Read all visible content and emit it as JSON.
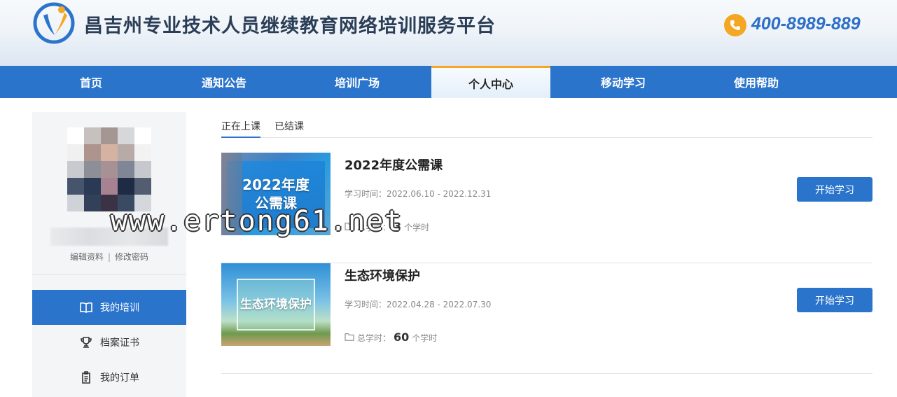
{
  "header": {
    "site_title": "昌吉州专业技术人员继续教育网络培训服务平台",
    "phone": "400-8989-889",
    "logo_icon": "platform-logo",
    "phone_icon": "phone-icon",
    "accent_color": "#2b74cc",
    "highlight_color": "#f5a623"
  },
  "nav": {
    "items": [
      {
        "label": "首页"
      },
      {
        "label": "通知公告"
      },
      {
        "label": "培训广场"
      },
      {
        "label": "个人中心",
        "active": true
      },
      {
        "label": "移动学习"
      },
      {
        "label": "使用帮助"
      }
    ]
  },
  "sidebar": {
    "edit_profile": "编辑资料",
    "separator": "|",
    "change_password": "修改密码",
    "items": [
      {
        "label": "我的培训",
        "icon": "book-icon",
        "active": true
      },
      {
        "label": "档案证书",
        "icon": "trophy-icon"
      },
      {
        "label": "我的订单",
        "icon": "clipboard-icon"
      }
    ]
  },
  "tabs": [
    {
      "label": "正在上课",
      "active": true
    },
    {
      "label": "已结课"
    }
  ],
  "courses": [
    {
      "title": "2022年度公需课",
      "thumb_text": "2022年度\n公需课",
      "dates": "学习时间：2022.06.10 - 2022.12.31",
      "hours_label": "总学时：",
      "hours_value": "3",
      "hours_unit": "个学时",
      "button": "开始学习"
    },
    {
      "title": "生态环境保护",
      "thumb_text": "生态环境保护",
      "dates": "学习时间：2022.04.28 - 2022.07.30",
      "hours_label": "总学时：",
      "hours_value": "60",
      "hours_unit": "个学时",
      "button": "开始学习"
    }
  ],
  "watermark": "www.ertong61.net"
}
